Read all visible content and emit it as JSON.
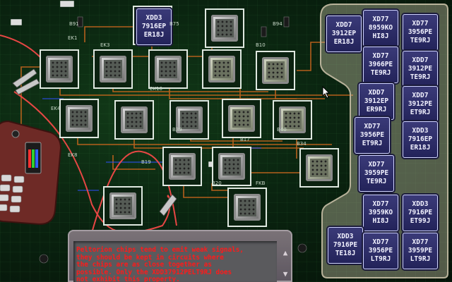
{
  "game": {
    "board_sockets": [
      {
        "id": "s1",
        "state": "empty"
      },
      {
        "id": "s2",
        "state": "empty"
      },
      {
        "id": "s3",
        "state": "empty"
      },
      {
        "id": "s4",
        "state": "empty"
      },
      {
        "id": "s5",
        "state": "empty"
      },
      {
        "id": "s6",
        "state": "empty"
      },
      {
        "id": "s7",
        "state": "empty"
      },
      {
        "id": "s8",
        "state": "empty"
      },
      {
        "id": "s9",
        "state": "empty"
      },
      {
        "id": "s10",
        "state": "empty"
      },
      {
        "id": "s11",
        "state": "empty"
      },
      {
        "id": "s12",
        "state": "empty"
      },
      {
        "id": "s13",
        "state": "empty"
      },
      {
        "id": "s14",
        "state": "empty"
      },
      {
        "id": "s15",
        "state": "empty"
      },
      {
        "id": "s16",
        "state": "empty"
      },
      {
        "id": "s17",
        "state": "empty"
      }
    ],
    "placed_chip": {
      "line1": "XDD3",
      "line2": "7916EP",
      "line3": "ER18J"
    },
    "tray_chips": [
      {
        "line1": "XDD7",
        "line2": "3912EP",
        "line3": "ER18J"
      },
      {
        "line1": "XD77",
        "line2": "8959KO",
        "line3": "HI8J"
      },
      {
        "line1": "XD77",
        "line2": "3956PE",
        "line3": "TE9RJ"
      },
      {
        "line1": "XD77",
        "line2": "3966PE",
        "line3": "TE9RJ"
      },
      {
        "line1": "XDD7",
        "line2": "3912PE",
        "line3": "TE9RJ"
      },
      {
        "line1": "XDD7",
        "line2": "3912EP",
        "line3": "ER9RJ"
      },
      {
        "line1": "XDD7",
        "line2": "3912PE",
        "line3": "ET9RJ"
      },
      {
        "line1": "XD77",
        "line2": "3956PE",
        "line3": "ET9RJ"
      },
      {
        "line1": "XDD3",
        "line2": "7916EP",
        "line3": "ER18J"
      },
      {
        "line1": "XD77",
        "line2": "3959PE",
        "line3": "TE9RJ"
      },
      {
        "line1": "XD77",
        "line2": "3959KO",
        "line3": "HI8J"
      },
      {
        "line1": "XDD3",
        "line2": "7916PE",
        "line3": "ET99J"
      },
      {
        "line1": "XDD3",
        "line2": "7916PE",
        "line3": "TE18J"
      },
      {
        "line1": "XD77",
        "line2": "3956PE",
        "line3": "LT9RJ"
      },
      {
        "line1": "XD77",
        "line2": "3959PE",
        "line3": "LT9RJ"
      }
    ],
    "message": "Peltorion chips tend to emit weak signals,\nthey should be kept in circuits where\nthe chips are as close together as\npossible. Only the XDD37912PELT9RJ does\nnot exhibit this property.",
    "board_labels": [
      "B91",
      "EK1",
      "B75",
      "B94",
      "EK3",
      "B10",
      "EK4",
      "EK8",
      "B19",
      "B17",
      "B34",
      "B20",
      "FKB",
      "EK10",
      "B39",
      "B40"
    ],
    "colors": {
      "board": "#0a2410",
      "trace": "#d2691e",
      "socket_border": "#dfe8e0",
      "chip_label_bg": "#2b2b66",
      "message_text": "#ff1a1a"
    }
  }
}
